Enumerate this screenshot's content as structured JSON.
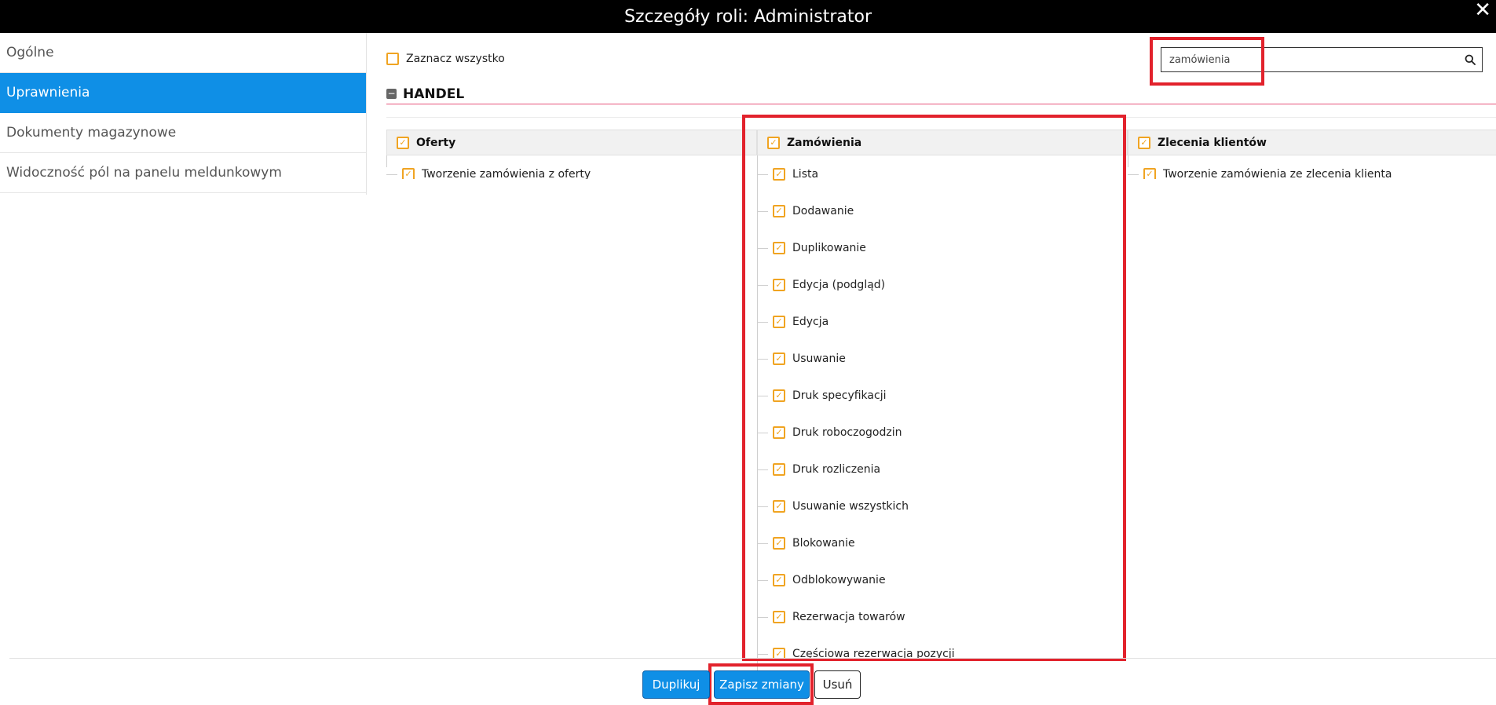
{
  "window": {
    "title": "Szczegóły roli: Administrator",
    "close_label": "✕"
  },
  "sidebar": {
    "items": [
      {
        "label": "Ogólne",
        "active": false
      },
      {
        "label": "Uprawnienia",
        "active": true
      },
      {
        "label": "Dokumenty magazynowe",
        "active": false
      },
      {
        "label": "Widoczność pól na panelu meldunkowym",
        "active": false
      }
    ]
  },
  "toolbar": {
    "select_all_label": "Zaznacz wszystko",
    "select_all_checked": false
  },
  "search": {
    "value": "zamówienia",
    "icon": "search-icon"
  },
  "section": {
    "title": "HANDEL",
    "collapse_symbol": "−"
  },
  "columns": [
    {
      "title": "Oferty",
      "items": [
        "Tworzenie zamówienia z oferty"
      ]
    },
    {
      "title": "Zamówienia",
      "items": [
        "Lista",
        "Dodawanie",
        "Duplikowanie",
        "Edycja (podgląd)",
        "Edycja",
        "Usuwanie",
        "Druk specyfikacji",
        "Druk roboczogodzin",
        "Druk rozliczenia",
        "Usuwanie wszystkich",
        "Blokowanie",
        "Odblokowywanie",
        "Rezerwacja towarów",
        "Częściowa rezerwacja pozycji"
      ]
    },
    {
      "title": "Zlecenia klientów",
      "items": [
        "Tworzenie zamówienia ze zlecenia klienta"
      ]
    }
  ],
  "footer": {
    "duplicate_label": "Duplikuj",
    "save_label": "Zapisz zmiany",
    "delete_label": "Usuń"
  },
  "colors": {
    "accent": "#0f8fe6",
    "checkbox": "#f0a422",
    "highlight": "#e2222c",
    "section_line": "#e8547a"
  }
}
